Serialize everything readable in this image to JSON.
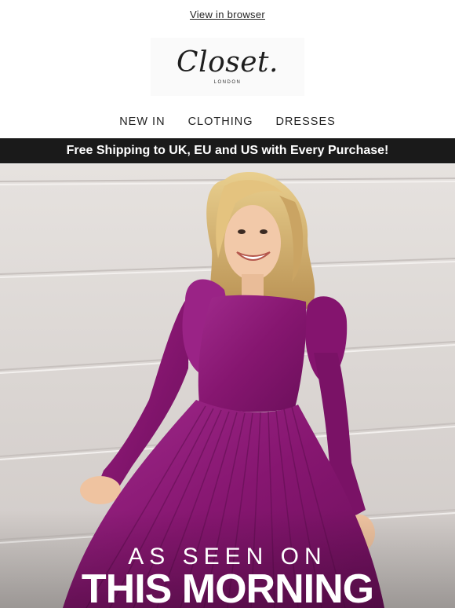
{
  "header": {
    "view_in_browser": "View in browser",
    "logo": {
      "name": "Closet.",
      "subtitle": "LONDON"
    }
  },
  "nav": {
    "items": [
      {
        "label": "NEW IN"
      },
      {
        "label": "CLOTHING"
      },
      {
        "label": "DRESSES"
      }
    ]
  },
  "banner": {
    "text": "Free Shipping to UK, EU and US with Every Purchase!"
  },
  "hero": {
    "line1": "AS SEEN ON",
    "line2": "THIS MORNING",
    "dress_color": "#8c1a78"
  },
  "colors": {
    "banner_bg": "#1a1a1a",
    "hero_wall": "#dcd8d6"
  }
}
